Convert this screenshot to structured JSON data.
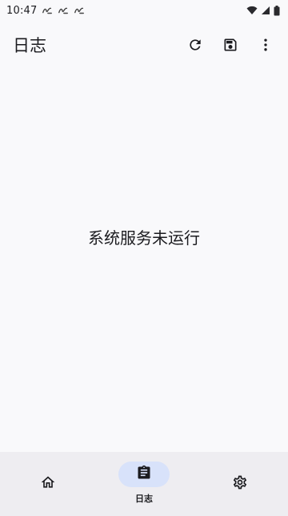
{
  "status_bar": {
    "time": "10:47",
    "notification_icons": [
      "notification-icon",
      "notification-icon",
      "notification-icon"
    ],
    "icons": [
      "wifi-icon",
      "signal-icon",
      "battery-icon"
    ]
  },
  "app_bar": {
    "title": "日志",
    "actions": [
      "refresh-icon",
      "save-icon",
      "more-vert-icon"
    ]
  },
  "main": {
    "empty_message": "系统服务未运行"
  },
  "bottom_nav": {
    "items": [
      {
        "id": "home",
        "icon": "home-icon",
        "label": "",
        "active": false
      },
      {
        "id": "logs",
        "icon": "clipboard-icon",
        "label": "日志",
        "active": true
      },
      {
        "id": "settings",
        "icon": "gear-icon",
        "label": "",
        "active": false
      }
    ]
  },
  "colors": {
    "background": "#f9f9fb",
    "nav_background": "#eeedf1",
    "active_pill": "#d8e2fa",
    "text": "#1b1b1f"
  }
}
